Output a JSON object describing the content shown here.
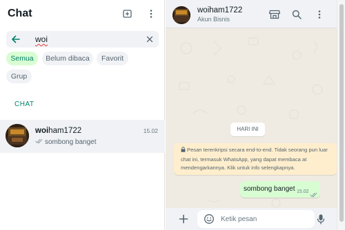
{
  "sidebar": {
    "title": "Chat",
    "search": {
      "query": "woi"
    },
    "filters": [
      {
        "label": "Semua",
        "active": true
      },
      {
        "label": "Belum dibaca",
        "active": false
      },
      {
        "label": "Favorit",
        "active": false
      },
      {
        "label": "Grup",
        "active": false
      }
    ],
    "section_label": "CHAT",
    "results": [
      {
        "name_match": "woi",
        "name_rest": "ham1722",
        "time": "15.02",
        "preview": "sombong banget"
      }
    ]
  },
  "conversation": {
    "contact_name": "woiham1722",
    "contact_subtitle": "Akun Bisnis",
    "date_divider": "HARI INI",
    "encryption_notice": "Pesan terenkripsi secara end-to-end. Tidak seorang pun luar chat ini, termasuk WhatsApp, yang dapat membaca at mendengarkannya. Klik untuk info selengkapnya.",
    "messages": [
      {
        "text": "sombong banget",
        "time": "15.02",
        "outgoing": true,
        "status": "read"
      }
    ],
    "composer": {
      "placeholder": "Ketik pesan"
    }
  },
  "colors": {
    "accent": "#008069",
    "chip_active_bg": "#d9fdd3",
    "outgoing_bubble": "#d9fdd3",
    "chat_bg": "#efeae2",
    "panel_bg": "#f0f2f5",
    "notice_bg": "#ffeecd",
    "read_tick": "#53bdeb"
  },
  "icons": {
    "new_chat": "new-chat-icon",
    "menu": "kebab-menu-icon",
    "back": "arrow-left-icon",
    "clear": "close-icon",
    "store": "store-icon",
    "search": "search-icon",
    "lock": "lock-icon",
    "attach": "plus-icon",
    "emoji": "emoji-icon",
    "mic": "mic-icon"
  }
}
